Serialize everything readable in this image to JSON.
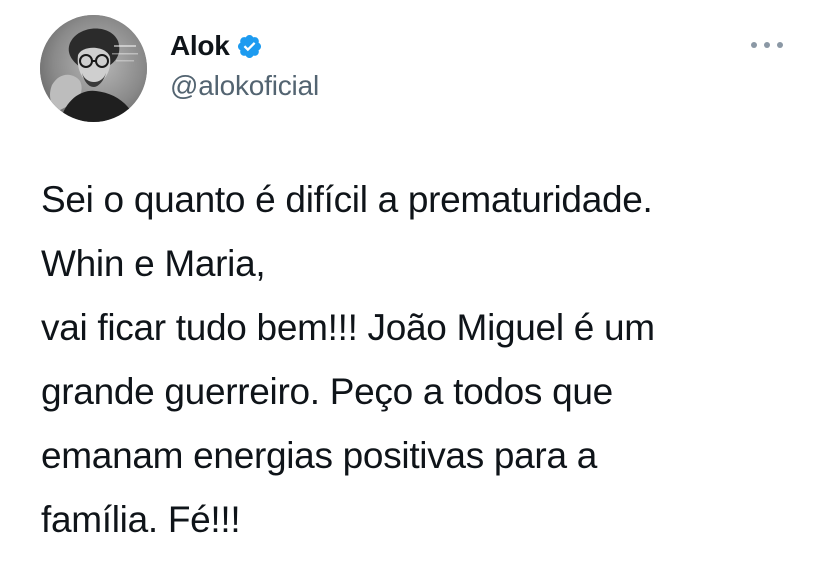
{
  "tweet": {
    "author": {
      "display_name": "Alok",
      "handle": "@alokoficial",
      "verified": true,
      "verified_icon": "verified-badge-icon",
      "avatar_icon": "avatar-photo"
    },
    "more_icon": "more-options-icon",
    "text_lines": [
      "Sei o quanto é difícil a prematuridade.",
      "Whin e Maria,",
      "vai ficar tudo bem!!! João Miguel é um",
      "grande guerreiro. Peço a todos que",
      "emanam energias positivas para a",
      "família. Fé!!!"
    ]
  },
  "colors": {
    "verified_blue": "#1d9bf0",
    "secondary_text": "#536471",
    "primary_text": "#0f1419",
    "more_dots": "#8b98a5"
  }
}
